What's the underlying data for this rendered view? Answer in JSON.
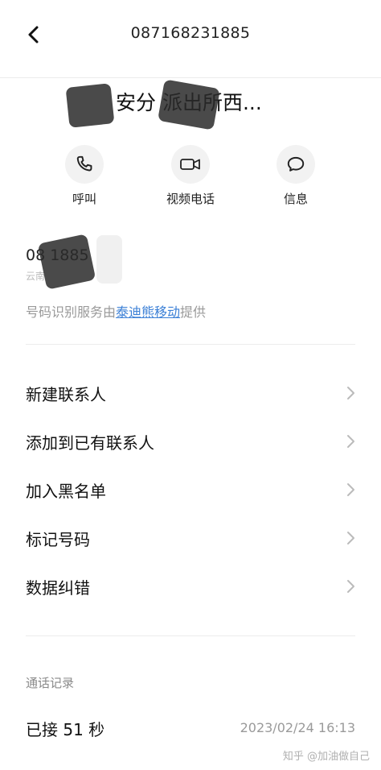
{
  "header": {
    "title": "087168231885"
  },
  "contact": {
    "name_suffix": "安分  派出所西..."
  },
  "actions": [
    {
      "label": "呼叫",
      "icon": "phone-icon"
    },
    {
      "label": "视频电话",
      "icon": "video-icon"
    },
    {
      "label": "信息",
      "icon": "message-icon"
    }
  ],
  "number_block": {
    "number_visible": "08        1885",
    "location": "云南"
  },
  "service": {
    "prefix": "号码识别服务由",
    "provider": "泰迪熊移动",
    "suffix": "提供"
  },
  "menu": [
    {
      "label": "新建联系人"
    },
    {
      "label": "添加到已有联系人"
    },
    {
      "label": "加入黑名单"
    },
    {
      "label": "标记号码"
    },
    {
      "label": "数据纠错"
    }
  ],
  "call_log": {
    "section_title": "通话记录",
    "status": "已接 51 秒",
    "time": "2023/02/24 16:13"
  },
  "watermark": "知乎 @加油做自己"
}
